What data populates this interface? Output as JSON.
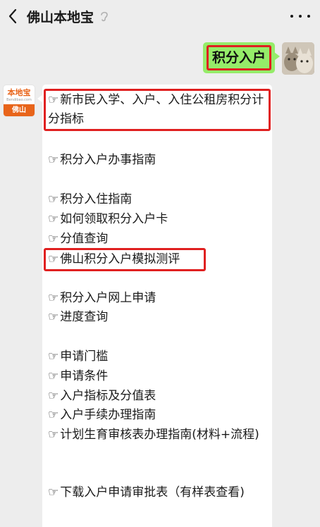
{
  "header": {
    "title": "佛山本地宝"
  },
  "user_message": {
    "text": "积分入户"
  },
  "bot": {
    "avatar_name": "本地宝",
    "avatar_domain": "Bendibao.com",
    "avatar_city": "佛山",
    "hand": "☞",
    "items": [
      "新市民入学、入户、入住公租房积分计分指标",
      "积分入户办事指南",
      "积分入住指南",
      "如何领取积分入户卡",
      "分值查询",
      "佛山积分入户模拟测评",
      "积分入户网上申请",
      "进度查询",
      "申请门槛",
      "申请条件",
      "入户指标及分值表",
      "入户手续办理指南",
      "计划生育审核表办理指南(材料+流程)",
      "下载入户申请审批表（有样表查看)"
    ]
  }
}
